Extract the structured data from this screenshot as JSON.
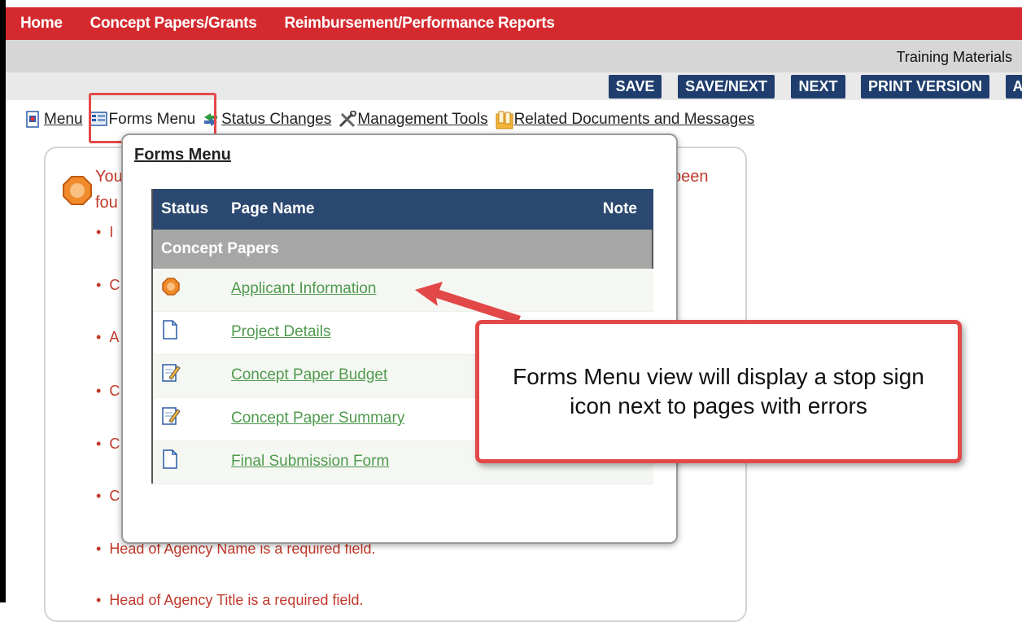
{
  "topnav": {
    "links": [
      "Home",
      "Concept Papers/Grants",
      "Reimbursement/Performance Reports"
    ]
  },
  "graybar": {
    "training_label": "Training Materials"
  },
  "buttons": {
    "save": "SAVE",
    "save_next": "SAVE/NEXT",
    "next": "NEXT",
    "print": "PRINT VERSION",
    "more": "A"
  },
  "toolbar": {
    "menu": "Menu",
    "forms_menu": "Forms Menu",
    "status_changes": "Status Changes",
    "management_tools": "Management Tools",
    "related_docs": "Related Documents and Messages"
  },
  "error_card": {
    "line1_start": "You",
    "line1_end": "been",
    "line2_start": "fou",
    "bullet_fragments": [
      "I",
      "C",
      "A",
      "C",
      "C",
      "C"
    ],
    "bullet_full_1": "Head of Agency Name is a required field.",
    "bullet_full_2": "Head of Agency Title is a required field."
  },
  "popup": {
    "title": "Forms Menu",
    "columns": {
      "status": "Status",
      "page_name": "Page Name",
      "note": "Note"
    },
    "section": "Concept Papers",
    "rows": [
      {
        "page": "Applicant Information",
        "icon": "stop-sign-icon"
      },
      {
        "page": "Project Details",
        "icon": "page-icon"
      },
      {
        "page": "Concept Paper Budget",
        "icon": "edit-page-icon"
      },
      {
        "page": "Concept Paper Summary",
        "icon": "edit-page-icon"
      },
      {
        "page": "Final Submission Form",
        "icon": "page-icon"
      }
    ]
  },
  "callout": {
    "text": "Forms Menu view will display a stop sign icon next to pages with errors"
  },
  "colors": {
    "nav_red": "#d42a2f",
    "button_navy": "#1f3e6e",
    "table_header": "#2b4870",
    "link_green": "#4e9a4e",
    "highlight_red": "#e34848"
  }
}
